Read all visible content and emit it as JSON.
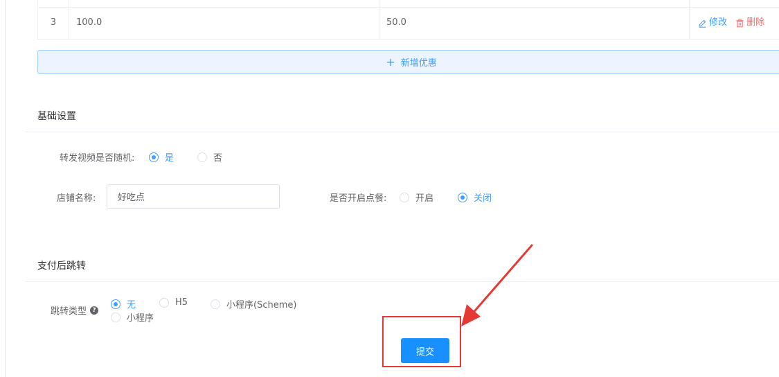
{
  "table": {
    "row": {
      "index": "3",
      "col_a": "100.0",
      "col_b": "50.0"
    },
    "actions": {
      "edit": "修改",
      "delete": "删除"
    }
  },
  "add_button": {
    "label": "新增优惠"
  },
  "basic_section": {
    "title": "基础设置",
    "random_video": {
      "label": "转发视频是否随机:",
      "options": [
        "是",
        "否"
      ],
      "selected": "是"
    },
    "shop_name": {
      "label": "店铺名称:",
      "value": "好吃点"
    },
    "ordering": {
      "label": "是否开启点餐:",
      "options": [
        "开启",
        "关闭"
      ],
      "selected": "关闭"
    }
  },
  "jump_section": {
    "title": "支付后跳转",
    "jump_type": {
      "label": "跳转类型",
      "options": [
        "无",
        "H5",
        "小程序(Scheme)",
        "小程序"
      ],
      "selected": "无"
    }
  },
  "submit": {
    "label": "提交"
  },
  "colors": {
    "primary": "#409eff",
    "danger": "#f56c6c",
    "annotation": "#e53935"
  }
}
